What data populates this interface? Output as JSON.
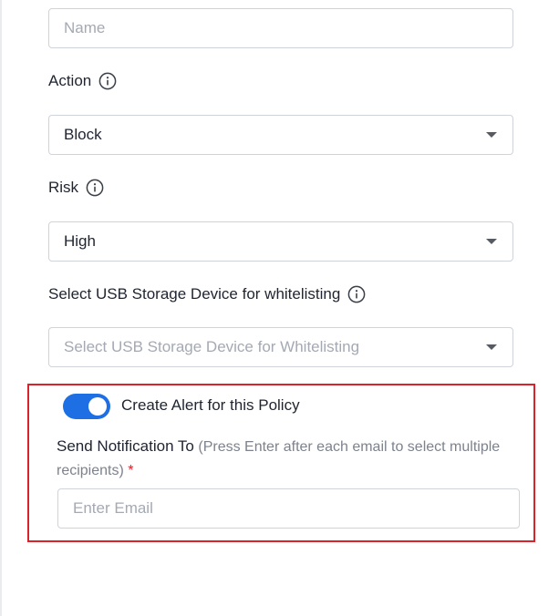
{
  "name_field": {
    "placeholder": "Name"
  },
  "action": {
    "label": "Action",
    "info_icon": "info-circle-icon",
    "selected": "Block"
  },
  "risk": {
    "label": "Risk",
    "info_icon": "info-circle-icon",
    "selected": "High"
  },
  "usb": {
    "label": "Select USB Storage Device for whitelisting",
    "info_icon": "info-circle-icon",
    "placeholder": "Select USB Storage Device for Whitelisting"
  },
  "alert": {
    "toggle_on": true,
    "toggle_label": "Create Alert for this Policy",
    "notify_label": "Send Notification To",
    "notify_hint": "(Press Enter after each email to select multiple recipients)",
    "required_mark": "*",
    "email_placeholder": "Enter Email"
  },
  "colors": {
    "toggle_on": "#1e6fe4",
    "highlight_border": "#d9222a",
    "required": "#d9222a"
  }
}
